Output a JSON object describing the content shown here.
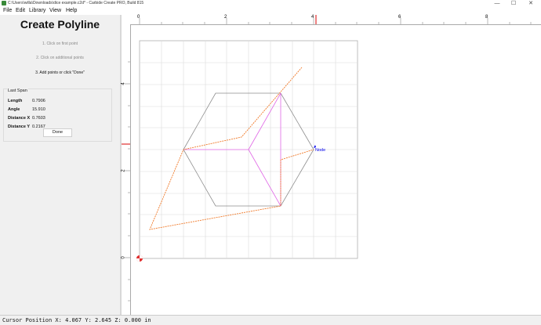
{
  "window": {
    "title": "C:\\Users\\willa\\Downloads\\dice example.c2d* - Carbide Create PRO, Build 815",
    "minimize_glyph": "—",
    "maximize_glyph": "☐",
    "close_glyph": "✕"
  },
  "menu": {
    "items": [
      "File",
      "Edit",
      "Library",
      "View",
      "Help"
    ]
  },
  "panel": {
    "title": "Create Polyline",
    "steps": [
      "1. Click on first point",
      "2. Click on additional points",
      "3. Add points or click \"Done\""
    ],
    "last_span": {
      "label": "Last Span",
      "rows": [
        {
          "label": "Length",
          "value": "0.7906"
        },
        {
          "label": "Angle",
          "value": "15.910"
        },
        {
          "label": "Distance X",
          "value": "0.7603"
        },
        {
          "label": "Distance Y",
          "value": "0.2167"
        }
      ]
    },
    "done_label": "Done"
  },
  "rulers": {
    "horizontal_labels": [
      "0",
      "2",
      "4",
      "6",
      "8"
    ],
    "vertical_labels": [
      "4",
      "2",
      "0"
    ]
  },
  "canvas": {
    "node_label": "Node",
    "colors": {
      "grid": "#dcdcdc",
      "hexagon": "#8c8c8c",
      "highlight": "#e066e6",
      "polyline": "#f07a2a",
      "cursor_marker": "#e03030",
      "node_label": "#0000ee"
    }
  },
  "status": {
    "text": "Cursor Position X: 4.067 Y: 2.645 Z: 0.000 in"
  }
}
